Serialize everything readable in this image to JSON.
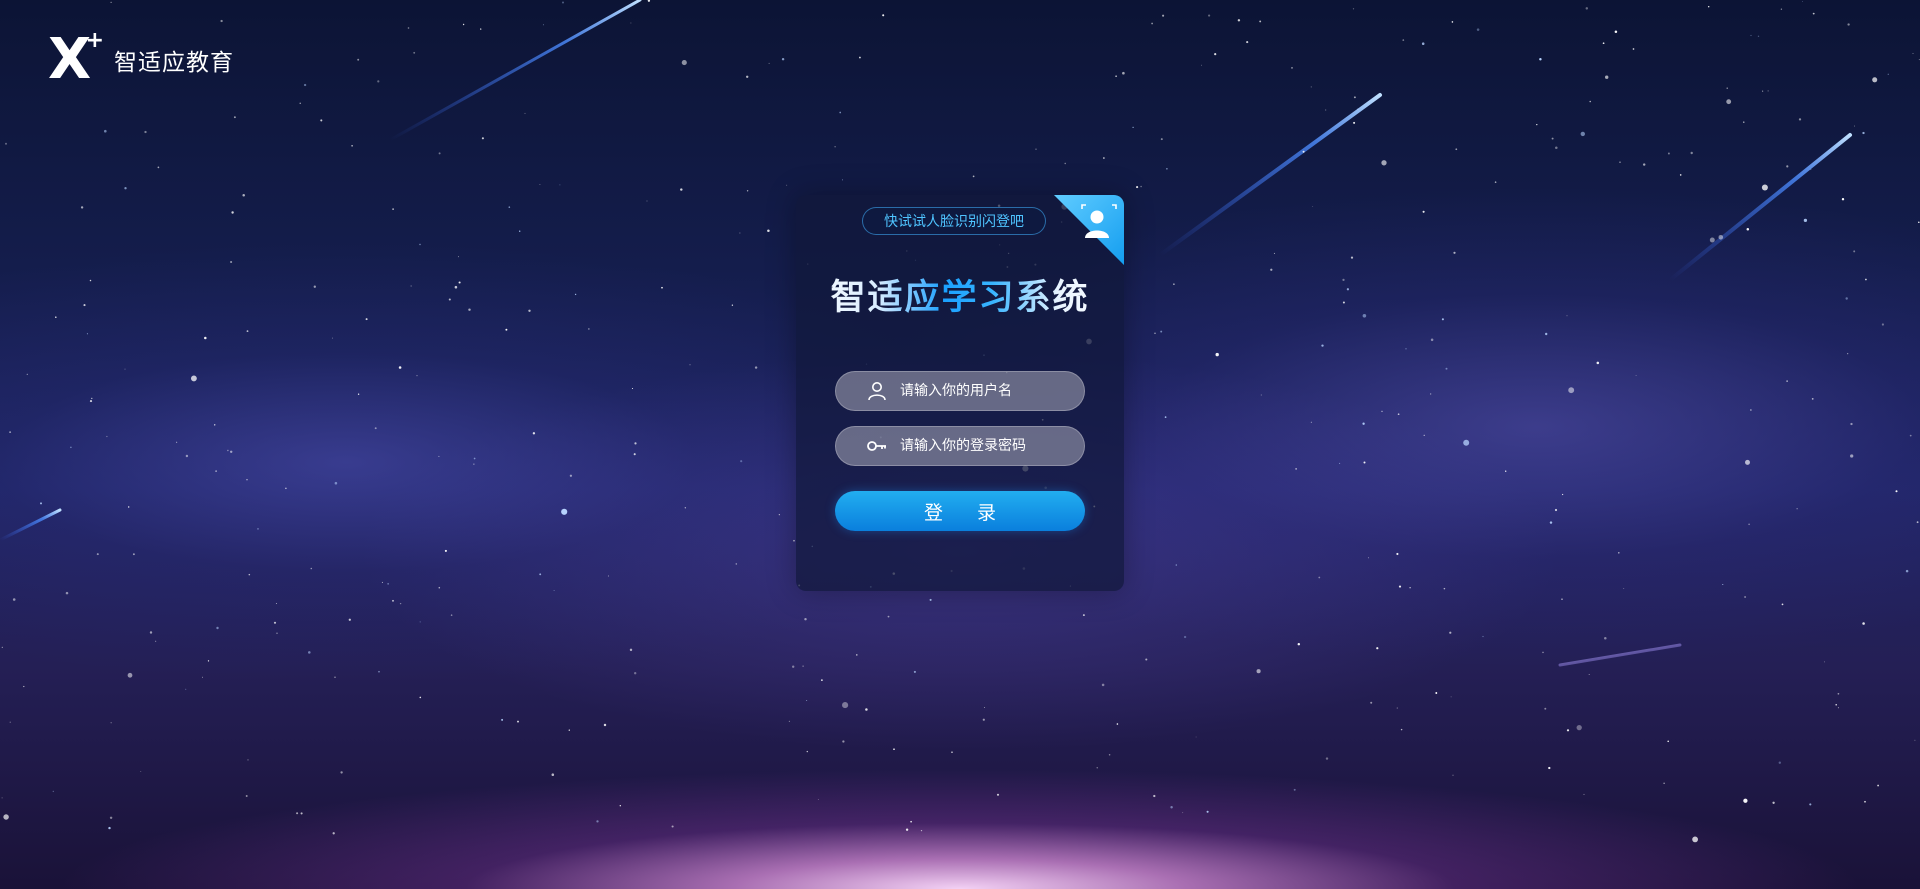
{
  "brand": {
    "logo_letter": "X",
    "logo_plus": "+",
    "name": "智适应教育"
  },
  "login_card": {
    "face_login_hint": "快试试人脸识别闪登吧",
    "title": "智适应学习系统",
    "username": {
      "placeholder": "请输入你的用户名",
      "value": "",
      "icon": "user-icon"
    },
    "password": {
      "placeholder": "请输入你的登录密码",
      "value": "",
      "icon": "key-icon"
    },
    "login_button": "登 录",
    "face_corner_icon": "face-recognition-icon"
  },
  "colors": {
    "accent": "#1aa0ff",
    "button_top": "#22aef0",
    "button_bottom": "#0a7fdd",
    "hint_text": "#4fc4ff",
    "background_dark": "#141d4c"
  }
}
